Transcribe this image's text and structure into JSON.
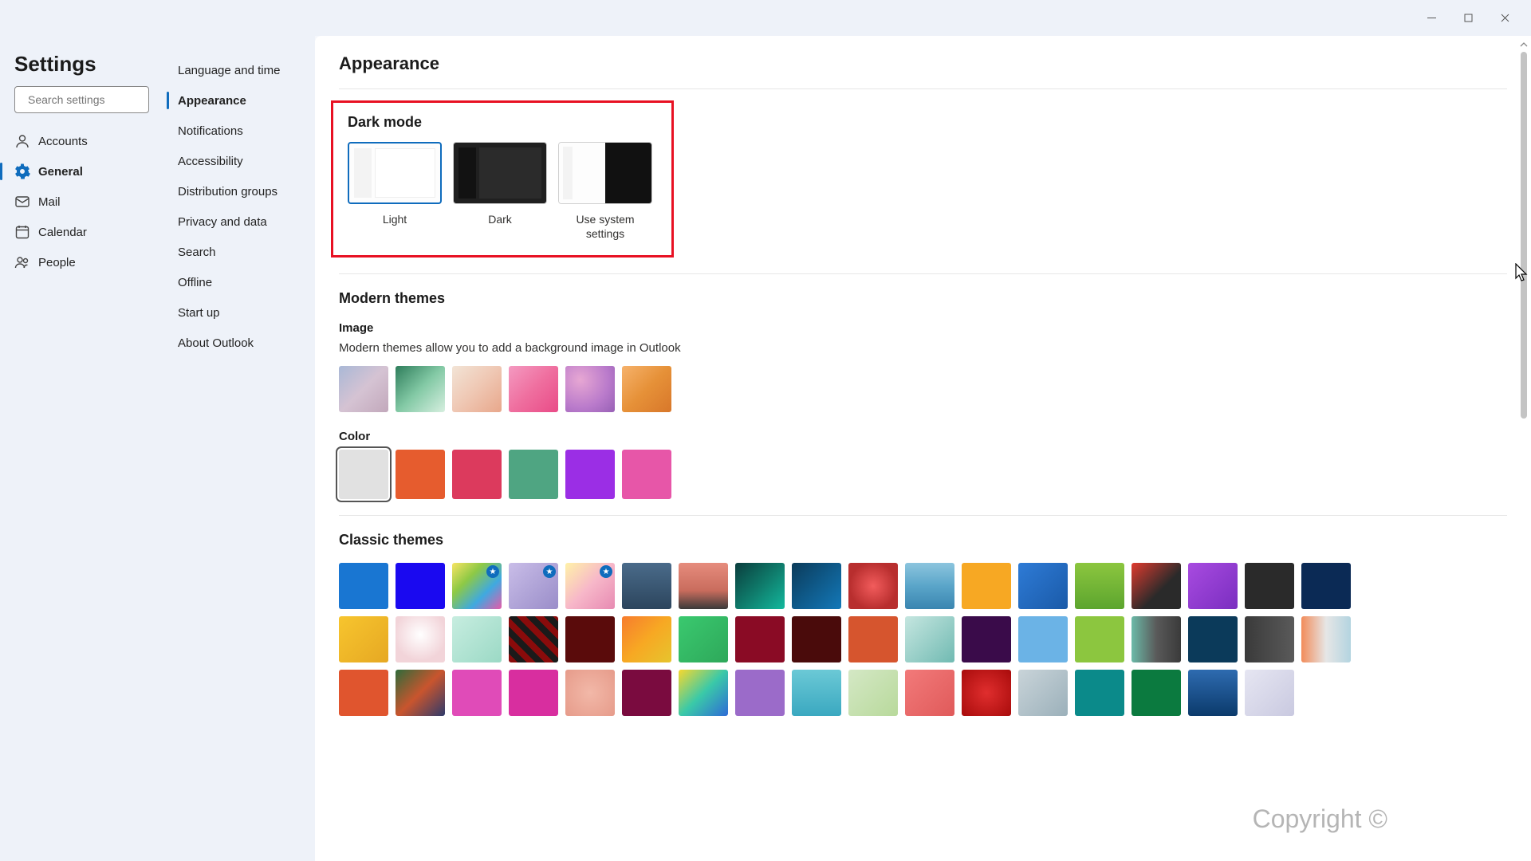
{
  "window": {
    "title": "Settings"
  },
  "search": {
    "placeholder": "Search settings"
  },
  "main_nav": [
    {
      "id": "accounts",
      "label": "Accounts",
      "active": false
    },
    {
      "id": "general",
      "label": "General",
      "active": true
    },
    {
      "id": "mail",
      "label": "Mail",
      "active": false
    },
    {
      "id": "calendar",
      "label": "Calendar",
      "active": false
    },
    {
      "id": "people",
      "label": "People",
      "active": false
    }
  ],
  "sub_nav": [
    {
      "id": "language",
      "label": "Language and time",
      "active": false
    },
    {
      "id": "appearance",
      "label": "Appearance",
      "active": true
    },
    {
      "id": "notifications",
      "label": "Notifications",
      "active": false
    },
    {
      "id": "accessibility",
      "label": "Accessibility",
      "active": false
    },
    {
      "id": "distribution",
      "label": "Distribution groups",
      "active": false
    },
    {
      "id": "privacy",
      "label": "Privacy and data",
      "active": false
    },
    {
      "id": "search",
      "label": "Search",
      "active": false
    },
    {
      "id": "offline",
      "label": "Offline",
      "active": false
    },
    {
      "id": "startup",
      "label": "Start up",
      "active": false
    },
    {
      "id": "about",
      "label": "About Outlook",
      "active": false
    }
  ],
  "page": {
    "title": "Appearance",
    "dark_mode": {
      "title": "Dark mode",
      "options": {
        "light": "Light",
        "dark": "Dark",
        "system": "Use system settings"
      },
      "selected": "light"
    },
    "modern": {
      "title": "Modern themes",
      "image_label": "Image",
      "desc": "Modern themes allow you to add a background image in Outlook",
      "image_swatches": [
        "linear-gradient(135deg,#a9b8d6,#d5c3d3,#c2a8bb)",
        "linear-gradient(135deg,#2e7d5b,#83c9a5,#d7efe0)",
        "linear-gradient(135deg,#f2e4d6,#efc7b3,#e8a78b)",
        "linear-gradient(135deg,#f49ac1,#ef6f9f,#e94b87)",
        "radial-gradient(circle at 30% 30%,#e7a7d3,#b97acb 60%,#9760b5)",
        "linear-gradient(135deg,#f6b26b,#e69138,#d8772a)"
      ],
      "color_label": "Color",
      "color_swatches": [
        {
          "color": "#e1e1e1",
          "selected": true
        },
        {
          "color": "#e65c2e",
          "selected": false
        },
        {
          "color": "#dc3a5d",
          "selected": false
        },
        {
          "color": "#4fa582",
          "selected": false
        },
        {
          "color": "#9b2ee5",
          "selected": false
        },
        {
          "color": "#e756a8",
          "selected": false
        }
      ]
    },
    "classic": {
      "title": "Classic themes",
      "row1": [
        {
          "bg": "#1976d2",
          "star": false
        },
        {
          "bg": "#1a09f0",
          "star": false
        },
        {
          "bg": "linear-gradient(135deg,#f7e463,#8ec945,#3fa9e0,#e75aa9)",
          "star": true
        },
        {
          "bg": "linear-gradient(135deg,#c9bde8,#b1a5d8,#9a8dc9)",
          "star": true
        },
        {
          "bg": "linear-gradient(135deg,#fff2a8,#f7b7c9,#e78ab2)",
          "star": true
        },
        {
          "bg": "linear-gradient(180deg,#4a6b8a,#2c455d)",
          "star": false
        },
        {
          "bg": "linear-gradient(180deg,#e68c7d,#c96c5d 60%,#3a3a3a)",
          "star": false
        },
        {
          "bg": "linear-gradient(135deg,#0a3d3d,#0f7a6a,#13b89d)",
          "star": false
        },
        {
          "bg": "linear-gradient(135deg,#0b3b5a,#0f5a8a,#1378b8)",
          "star": false
        },
        {
          "bg": "radial-gradient(circle,#f25c5c,#b82e2e 70%)",
          "star": false
        },
        {
          "bg": "linear-gradient(180deg,#8cc5de,#5aa5c9,#3a85b0)",
          "star": false
        },
        {
          "bg": "#f7a823",
          "star": false
        },
        {
          "bg": "linear-gradient(135deg,#2e7bd6,#1a5aa8)",
          "star": false
        },
        {
          "bg": "linear-gradient(180deg,#8cc63f,#5ca52e)",
          "star": false
        },
        {
          "bg": "linear-gradient(135deg,#e03a2e,#2a2a2a 60%)",
          "star": false
        },
        {
          "bg": "linear-gradient(135deg,#a84be0,#7a2ec0)",
          "star": false
        },
        {
          "bg": "#2a2a2a",
          "star": false
        },
        {
          "bg": "#0b2a55",
          "star": false
        }
      ],
      "row2": [
        {
          "bg": "linear-gradient(135deg,#f7c52e,#e6a823)"
        },
        {
          "bg": "radial-gradient(circle at 50% 40%,#fff,#f2d4d9 70%)"
        },
        {
          "bg": "linear-gradient(135deg,#c7ede0,#9bd9c5)"
        },
        {
          "bg": "repeating-linear-gradient(45deg,#8a0b0b 0 8px,#1a1a1a 8px 16px)"
        },
        {
          "bg": "#5a0b0b"
        },
        {
          "bg": "linear-gradient(135deg,#f77c2e,#f7a823,#e6c52e)"
        },
        {
          "bg": "linear-gradient(135deg,#3ac96f,#2ea85a)"
        },
        {
          "bg": "#8a0b25"
        },
        {
          "bg": "#4a0b0b"
        },
        {
          "bg": "#d6552e"
        },
        {
          "bg": "linear-gradient(135deg,#c5e6e0,#9bd0c9,#70bab2)"
        },
        {
          "bg": "#3a0b4a"
        },
        {
          "bg": "#6bb3e6"
        },
        {
          "bg": "#8cc63f"
        },
        {
          "bg": "linear-gradient(90deg,#6bbaa8,#5a5a5a 50%,#3a3a3a)"
        },
        {
          "bg": "#0b3a5a"
        },
        {
          "bg": "linear-gradient(90deg,#3a3a3a,#5a5a5a)"
        },
        {
          "bg": "linear-gradient(90deg,#f28c5a,#e6e6e6 50%,#b3d4e0)"
        }
      ],
      "row3": [
        {
          "bg": "#e0552e"
        },
        {
          "bg": "linear-gradient(135deg,#2e6b3a,#c9552e,#2e3a6b)"
        },
        {
          "bg": "#e04bb8"
        },
        {
          "bg": "#d82e9f"
        },
        {
          "bg": "radial-gradient(circle,#f2b8a8,#e69b8a)"
        },
        {
          "bg": "#7a0b3f"
        },
        {
          "bg": "linear-gradient(135deg,#f7d82e,#3ac9a8,#2e6bd6)"
        },
        {
          "bg": "#9b6bc9"
        },
        {
          "bg": "linear-gradient(180deg,#6bc9d6,#3aa8c0)"
        },
        {
          "bg": "linear-gradient(135deg,#d4e8c5,#b8d99b)"
        },
        {
          "bg": "linear-gradient(135deg,#f27a7a,#e05a5a)"
        },
        {
          "bg": "radial-gradient(circle,#e02e2e,#a80b0b)"
        },
        {
          "bg": "linear-gradient(135deg,#c9d4d9,#9bb0ba)"
        },
        {
          "bg": "#0b8a8a"
        },
        {
          "bg": "#0b7a3f"
        },
        {
          "bg": "linear-gradient(180deg,#2e6bb0,#0b3a6b)"
        },
        {
          "bg": "linear-gradient(135deg,#e6e6f2,#c9c9e0)"
        }
      ]
    }
  },
  "watermark": "Copyright ©"
}
